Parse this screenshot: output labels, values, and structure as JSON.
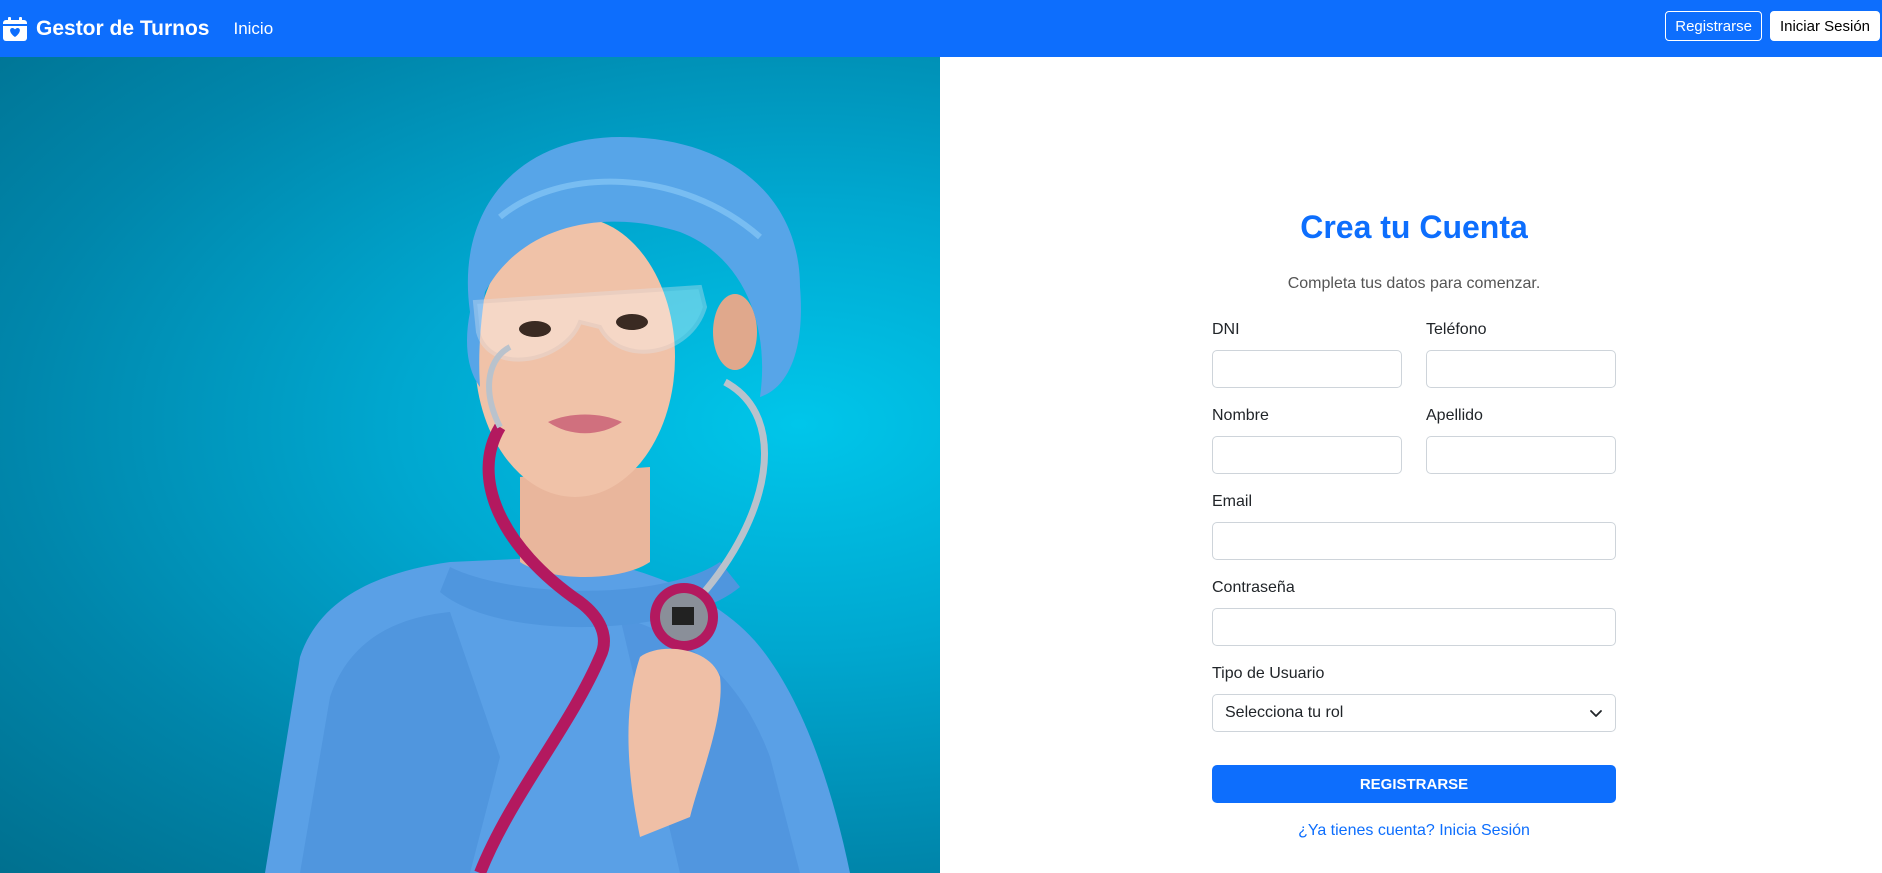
{
  "navbar": {
    "brand": "Gestor de Turnos",
    "brand_icon": "calendar-heart-icon",
    "home_link": "Inicio",
    "register_button": "Registrarse",
    "login_button": "Iniciar Sesión",
    "color": "#0d6efd"
  },
  "hero": {
    "image": "doctor-with-stethoscope",
    "background_color": "#00a8d0"
  },
  "form": {
    "title": "Crea tu Cuenta",
    "subtitle": "Completa tus datos para comenzar.",
    "fields": {
      "dni": {
        "label": "DNI",
        "value": ""
      },
      "telefono": {
        "label": "Teléfono",
        "value": ""
      },
      "nombre": {
        "label": "Nombre",
        "value": ""
      },
      "apellido": {
        "label": "Apellido",
        "value": ""
      },
      "email": {
        "label": "Email",
        "value": ""
      },
      "password": {
        "label": "Contraseña",
        "value": ""
      }
    },
    "user_type": {
      "label": "Tipo de Usuario",
      "selected": "Selecciona tu rol",
      "icon": "chevron-down-icon"
    },
    "submit_button": "REGISTRARSE",
    "login_link": "¿Ya tienes cuenta? Inicia Sesión",
    "accent_color": "#0d6efd"
  }
}
